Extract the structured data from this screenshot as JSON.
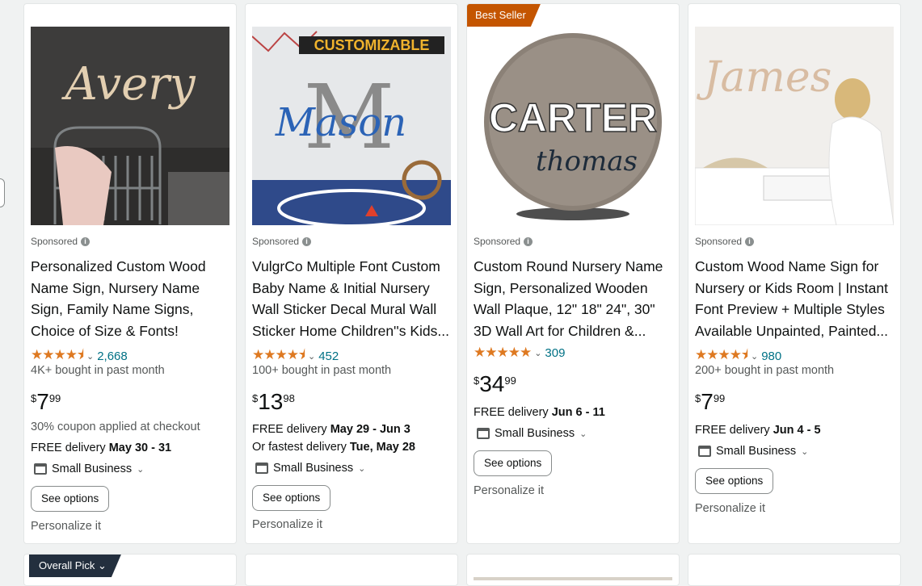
{
  "products": [
    {
      "sponsored": "Sponsored",
      "title": "Personalized Custom Wood Name Sign, Nursery Name Sign, Family Name Signs, Choice of Size & Fonts!",
      "stars": "★★★★⯨",
      "reviews": "2,668",
      "bought": "4K+ bought in past month",
      "price_symbol": "$",
      "price_whole": "7",
      "price_fraction": "99",
      "coupon": "30% coupon applied at checkout",
      "delivery_prefix": "FREE delivery ",
      "delivery_date": "May 30 - 31",
      "small_business": "Small Business",
      "see_options": "See options",
      "personalize": "Personalize it",
      "image_text": "Avery"
    },
    {
      "sponsored": "Sponsored",
      "title": "VulgrCo Multiple Font Custom Baby Name & Initial Nursery Wall Sticker Decal Mural Wall Sticker Home Children''s Kids...",
      "stars": "★★★★⯨",
      "reviews": "452",
      "bought": "100+ bought in past month",
      "price_symbol": "$",
      "price_whole": "13",
      "price_fraction": "98",
      "delivery_prefix": "FREE delivery ",
      "delivery_date": "May 29 - Jun 3",
      "fastest_prefix": "Or fastest delivery ",
      "fastest_date": "Tue, May 28",
      "small_business": "Small Business",
      "see_options": "See options",
      "personalize": "Personalize it",
      "image_banner": "CUSTOMIZABLE",
      "image_letter": "M",
      "image_text": "Mason"
    },
    {
      "badge": "Best Seller",
      "sponsored": "Sponsored",
      "title": "Custom Round Nursery Name Sign, Personalized Wooden Wall Plaque, 12\" 18\" 24\", 30\" 3D Wall Art for Children &...",
      "stars": "★★★★★",
      "reviews": "309",
      "price_symbol": "$",
      "price_whole": "34",
      "price_fraction": "99",
      "delivery_prefix": "FREE delivery ",
      "delivery_date": "Jun 6 - 11",
      "small_business": "Small Business",
      "see_options": "See options",
      "personalize": "Personalize it",
      "image_text": "CARTER",
      "image_subtext": "thomas"
    },
    {
      "sponsored": "Sponsored",
      "title": "Custom Wood Name Sign for Nursery or Kids Room | Instant Font Preview + Multiple Styles Available Unpainted, Painted...",
      "stars": "★★★★⯨",
      "reviews": "980",
      "bought": "200+ bought in past month",
      "price_symbol": "$",
      "price_whole": "7",
      "price_fraction": "99",
      "delivery_prefix": "FREE delivery ",
      "delivery_date": "Jun 4 - 5",
      "small_business": "Small Business",
      "see_options": "See options",
      "personalize": "Personalize it",
      "image_text": "James"
    }
  ],
  "row2": {
    "badge": "Overall Pick"
  },
  "colors": {
    "star": "#de7921",
    "link": "#007185",
    "badge": "#c45500",
    "overall_badge": "#232f3e"
  },
  "icons": [
    "info-icon",
    "star-icon",
    "chevron-down-icon",
    "small-business-icon"
  ]
}
